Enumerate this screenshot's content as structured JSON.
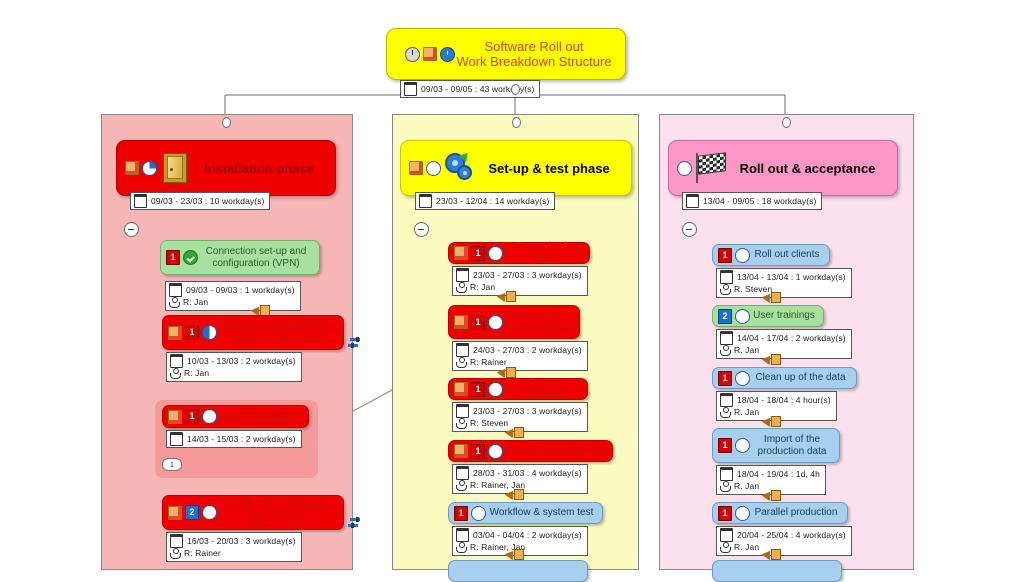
{
  "root": {
    "title_line1": "Software Roll out",
    "title_line2": "Work Breakdown Structure",
    "icons": [
      "clock-icon",
      "note-icon",
      "progress-clock-icon"
    ],
    "info": {
      "dates": "09/03 - 09/05 : 43 workday(s)"
    }
  },
  "columns": [
    {
      "name": "installation-phase",
      "color": "#f7b6b6"
    },
    {
      "name": "setup-test-phase",
      "color": "#fbfbc0"
    },
    {
      "name": "rollout-acceptance-phase",
      "color": "#fbe0ee"
    }
  ],
  "phases": [
    {
      "id": "installation",
      "title": "Installation phase",
      "icons": [
        "note-icon",
        "progress-pie-icon"
      ],
      "pictogram": "door-icon",
      "info": {
        "dates": "09/03 - 23/03 : 10 workday(s)"
      }
    },
    {
      "id": "setup-test",
      "title": "Set-up & test phase",
      "icons": [
        "note-icon",
        "progress-circle-icon"
      ],
      "pictogram": "gears-icon",
      "info": {
        "dates": "23/03 - 12/04 : 14 workday(s)"
      }
    },
    {
      "id": "rollout",
      "title": "Roll out & acceptance",
      "icons": [
        "progress-circle-icon"
      ],
      "pictogram": "checkered-flag-icon",
      "info": {
        "dates": "13/04 - 09/05 : 18 workday(s)"
      }
    }
  ],
  "tasks": {
    "installation": [
      {
        "label": "Connection set-up and configuration (VPN)",
        "style": "green",
        "priority": "1",
        "priority_color": "#d60000",
        "status": "check-icon",
        "note": false,
        "link": false,
        "info": {
          "dates": "09/03 - 09/03 : 1 workday(s)",
          "resource": "R: Jan"
        }
      },
      {
        "label": "Delivery & configuration system environment",
        "style": "red",
        "priority": "1",
        "priority_color": "#d60000",
        "status": "progress-half-icon",
        "note": true,
        "link": true,
        "info": {
          "dates": "10/03 - 13/03 : 2 workday(s)",
          "resource": "R: Jan"
        }
      },
      {
        "label": "Basic installation",
        "style": "red",
        "priority": "1",
        "priority_color": "#d60000",
        "status": "progress-circle-icon",
        "note": true,
        "link": false,
        "collapsed_children": "1",
        "info": {
          "dates": "14/03 - 15/03 : 2 workday(s)"
        }
      },
      {
        "label": "Configuration, backup & maintenance",
        "style": "red",
        "priority": "2",
        "priority_color": "#1c6fd6",
        "status": "progress-circle-icon",
        "note": true,
        "link": true,
        "info": {
          "dates": "16/03 - 20/03 : 3 workday(s)",
          "resource": "R: Rainer"
        }
      }
    ],
    "setup-test": [
      {
        "label": "Create basic data",
        "style": "red",
        "priority": "1",
        "priority_color": "#d60000",
        "status": "progress-circle-icon",
        "note": true,
        "link": false,
        "info": {
          "dates": "23/03 - 27/03 : 3 workday(s)",
          "resource": "R: Jan"
        }
      },
      {
        "label": "Set up user administration",
        "style": "red",
        "priority": "1",
        "priority_color": "#d60000",
        "status": "progress-circle-icon",
        "note": true,
        "link": false,
        "info": {
          "dates": "24/03 - 27/03 : 2 workday(s)",
          "resource": "R: Rainer"
        }
      },
      {
        "label": "Set up interfaces",
        "style": "red",
        "priority": "1",
        "priority_color": "#d60000",
        "status": "progress-circle-icon",
        "note": true,
        "link": false,
        "info": {
          "dates": "23/03 - 27/03 : 3 workday(s)",
          "resource": "R: Steven"
        }
      },
      {
        "label": "Customizing workflow",
        "style": "red",
        "priority": "1",
        "priority_color": "#d60000",
        "status": "progress-circle-icon",
        "note": true,
        "link": false,
        "info": {
          "dates": "28/03 - 31/03 : 4 workday(s)",
          "resource": "R: Rainer, Jan"
        }
      },
      {
        "label": "Workflow & system test",
        "style": "blue",
        "priority": "1",
        "priority_color": "#d60000",
        "status": "progress-circle-icon",
        "note": false,
        "link": false,
        "info": {
          "dates": "03/04 - 04/04 : 2 workday(s)",
          "resource": "R: Rainer, Jan"
        }
      }
    ],
    "rollout": [
      {
        "label": "Roll out clients",
        "style": "blue",
        "priority": "1",
        "priority_color": "#d60000",
        "status": "progress-circle-icon",
        "note": false,
        "link": false,
        "info": {
          "dates": "13/04 - 13/04 : 1 workday(s)",
          "resource": "R. Steven"
        }
      },
      {
        "label": "User trainings",
        "style": "green",
        "priority": "2",
        "priority_color": "#1c6fd6",
        "status": "progress-circle-icon",
        "note": false,
        "link": false,
        "info": {
          "dates": "14/04 - 17/04 : 2 workday(s)",
          "resource": "R. Jan"
        }
      },
      {
        "label": "Clean up of the data",
        "style": "blue",
        "priority": "1",
        "priority_color": "#d60000",
        "status": "progress-circle-icon",
        "note": false,
        "link": false,
        "info": {
          "dates": "18/04 - 18/04 : 4 hour(s)",
          "resource": "R. Jan"
        }
      },
      {
        "label": "Import of the production data",
        "style": "blue",
        "priority": "1",
        "priority_color": "#d60000",
        "status": "progress-circle-icon",
        "note": false,
        "link": false,
        "info": {
          "dates": "18/04 - 19/04 : 1d, 4h",
          "resource": "R. Jan"
        }
      },
      {
        "label": "Parallel production",
        "style": "blue",
        "priority": "1",
        "priority_color": "#d60000",
        "status": "progress-circle-icon",
        "note": false,
        "link": false,
        "info": {
          "dates": "20/04 - 25/04 : 4 workday(s)",
          "resource": "R. Jan"
        }
      }
    ]
  }
}
